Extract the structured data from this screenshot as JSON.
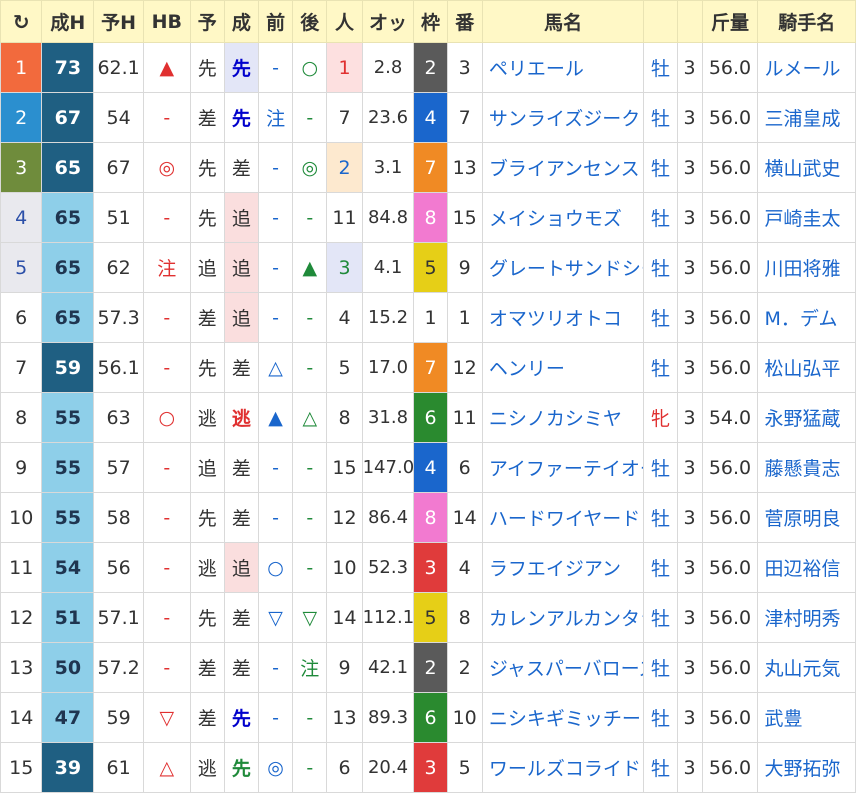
{
  "header": {
    "refresh_icon": "↻",
    "cols": [
      "成H",
      "予H",
      "HB",
      "予",
      "成",
      "前",
      "後",
      "人",
      "オッ",
      "枠",
      "番",
      "馬名",
      "",
      "",
      "斤量",
      "騎手名"
    ]
  },
  "rows": [
    {
      "rank": "1",
      "seiH": "73",
      "yoH": "62.1",
      "hb": "▲",
      "yo": "先",
      "sei": "先",
      "mae": "-",
      "ato": "○",
      "pop": "1",
      "odds": "2.8",
      "waku": "2",
      "ban": "3",
      "name": "ペリエール",
      "sex": "牡",
      "age": "3",
      "kin": "56.0",
      "jockey": "ルメール"
    },
    {
      "rank": "2",
      "seiH": "67",
      "yoH": "54",
      "hb": "-",
      "yo": "差",
      "sei": "先",
      "mae": "注",
      "ato": "-",
      "pop": "7",
      "odds": "23.6",
      "waku": "4",
      "ban": "7",
      "name": "サンライズジーク",
      "sex": "牡",
      "age": "3",
      "kin": "56.0",
      "jockey": "三浦皇成"
    },
    {
      "rank": "3",
      "seiH": "65",
      "yoH": "67",
      "hb": "◎",
      "yo": "先",
      "sei": "差",
      "mae": "-",
      "ato": "◎",
      "pop": "2",
      "odds": "3.1",
      "waku": "7",
      "ban": "13",
      "name": "ブライアンセンス",
      "sex": "牡",
      "age": "3",
      "kin": "56.0",
      "jockey": "横山武史"
    },
    {
      "rank": "4",
      "seiH": "65",
      "yoH": "51",
      "hb": "-",
      "yo": "先",
      "sei": "追",
      "mae": "-",
      "ato": "-",
      "pop": "11",
      "odds": "84.8",
      "waku": "8",
      "ban": "15",
      "name": "メイショウモズ",
      "sex": "牡",
      "age": "3",
      "kin": "56.0",
      "jockey": "戸崎圭太"
    },
    {
      "rank": "5",
      "seiH": "65",
      "yoH": "62",
      "hb": "注",
      "yo": "追",
      "sei": "追",
      "mae": "-",
      "ato": "▲",
      "pop": "3",
      "odds": "4.1",
      "waku": "5",
      "ban": "9",
      "name": "グレートサンドシー",
      "sex": "牡",
      "age": "3",
      "kin": "56.0",
      "jockey": "川田将雅"
    },
    {
      "rank": "6",
      "seiH": "65",
      "yoH": "57.3",
      "hb": "-",
      "yo": "差",
      "sei": "追",
      "mae": "-",
      "ato": "-",
      "pop": "4",
      "odds": "15.2",
      "waku": "1",
      "ban": "1",
      "name": "オマツリオトコ",
      "sex": "牡",
      "age": "3",
      "kin": "56.0",
      "jockey": "M．デム"
    },
    {
      "rank": "7",
      "seiH": "59",
      "yoH": "56.1",
      "hb": "-",
      "yo": "先",
      "sei": "差",
      "mae": "△",
      "ato": "-",
      "pop": "5",
      "odds": "17.0",
      "waku": "7",
      "ban": "12",
      "name": "ヘンリー",
      "sex": "牡",
      "age": "3",
      "kin": "56.0",
      "jockey": "松山弘平"
    },
    {
      "rank": "8",
      "seiH": "55",
      "yoH": "63",
      "hb": "○",
      "yo": "逃",
      "sei": "逃",
      "mae": "▲",
      "ato": "△",
      "pop": "8",
      "odds": "31.8",
      "waku": "6",
      "ban": "11",
      "name": "ニシノカシミヤ",
      "sex": "牝",
      "age": "3",
      "kin": "54.0",
      "jockey": "永野猛蔵"
    },
    {
      "rank": "9",
      "seiH": "55",
      "yoH": "57",
      "hb": "-",
      "yo": "追",
      "sei": "差",
      "mae": "-",
      "ato": "-",
      "pop": "15",
      "odds": "147.0",
      "waku": "4",
      "ban": "6",
      "name": "アイファーテイオー",
      "sex": "牡",
      "age": "3",
      "kin": "56.0",
      "jockey": "藤懸貴志"
    },
    {
      "rank": "10",
      "seiH": "55",
      "yoH": "58",
      "hb": "-",
      "yo": "先",
      "sei": "差",
      "mae": "-",
      "ato": "-",
      "pop": "12",
      "odds": "86.4",
      "waku": "8",
      "ban": "14",
      "name": "ハードワイヤード",
      "sex": "牡",
      "age": "3",
      "kin": "56.0",
      "jockey": "菅原明良"
    },
    {
      "rank": "11",
      "seiH": "54",
      "yoH": "56",
      "hb": "-",
      "yo": "逃",
      "sei": "追",
      "mae": "○",
      "ato": "-",
      "pop": "10",
      "odds": "52.3",
      "waku": "3",
      "ban": "4",
      "name": "ラフエイジアン",
      "sex": "牡",
      "age": "3",
      "kin": "56.0",
      "jockey": "田辺裕信"
    },
    {
      "rank": "12",
      "seiH": "51",
      "yoH": "57.1",
      "hb": "-",
      "yo": "先",
      "sei": "差",
      "mae": "▽",
      "ato": "▽",
      "pop": "14",
      "odds": "112.1",
      "waku": "5",
      "ban": "8",
      "name": "カレンアルカンタラ",
      "sex": "牡",
      "age": "3",
      "kin": "56.0",
      "jockey": "津村明秀"
    },
    {
      "rank": "13",
      "seiH": "50",
      "yoH": "57.2",
      "hb": "-",
      "yo": "差",
      "sei": "差",
      "mae": "-",
      "ato": "注",
      "pop": "9",
      "odds": "42.1",
      "waku": "2",
      "ban": "2",
      "name": "ジャスパーバローズ",
      "sex": "牡",
      "age": "3",
      "kin": "56.0",
      "jockey": "丸山元気"
    },
    {
      "rank": "14",
      "seiH": "47",
      "yoH": "59",
      "hb": "▽",
      "yo": "差",
      "sei": "先",
      "mae": "-",
      "ato": "-",
      "pop": "13",
      "odds": "89.3",
      "waku": "6",
      "ban": "10",
      "name": "ニシキギミッチー",
      "sex": "牡",
      "age": "3",
      "kin": "56.0",
      "jockey": "武豊"
    },
    {
      "rank": "15",
      "seiH": "39",
      "yoH": "61",
      "hb": "△",
      "yo": "逃",
      "sei": "先",
      "mae": "◎",
      "ato": "-",
      "pop": "6",
      "odds": "20.4",
      "waku": "3",
      "ban": "5",
      "name": "ワールズコライド",
      "sex": "牡",
      "age": "3",
      "kin": "56.0",
      "jockey": "大野拓弥"
    }
  ],
  "colors": {
    "header_bg": "#fff8c6",
    "rank1": "#f26a3d",
    "rank2": "#2b8fcf",
    "rank3": "#6f8c3c",
    "rank45": "#e9e9ee",
    "seiH_dark": "#1f5f82",
    "seiH_light": "#8ecfe9",
    "pop1": "#fde0e0",
    "pop2": "#fde9cf",
    "pop3": "#e3e6f7",
    "waku_1": "#ffffff",
    "waku_2": "#5a5a5a",
    "waku_3": "#e03b3b",
    "waku_4": "#1a66cc",
    "waku_5": "#e6cf17",
    "waku_6": "#2a8a2f",
    "waku_7": "#f08a24",
    "waku_8": "#f27ad0"
  }
}
